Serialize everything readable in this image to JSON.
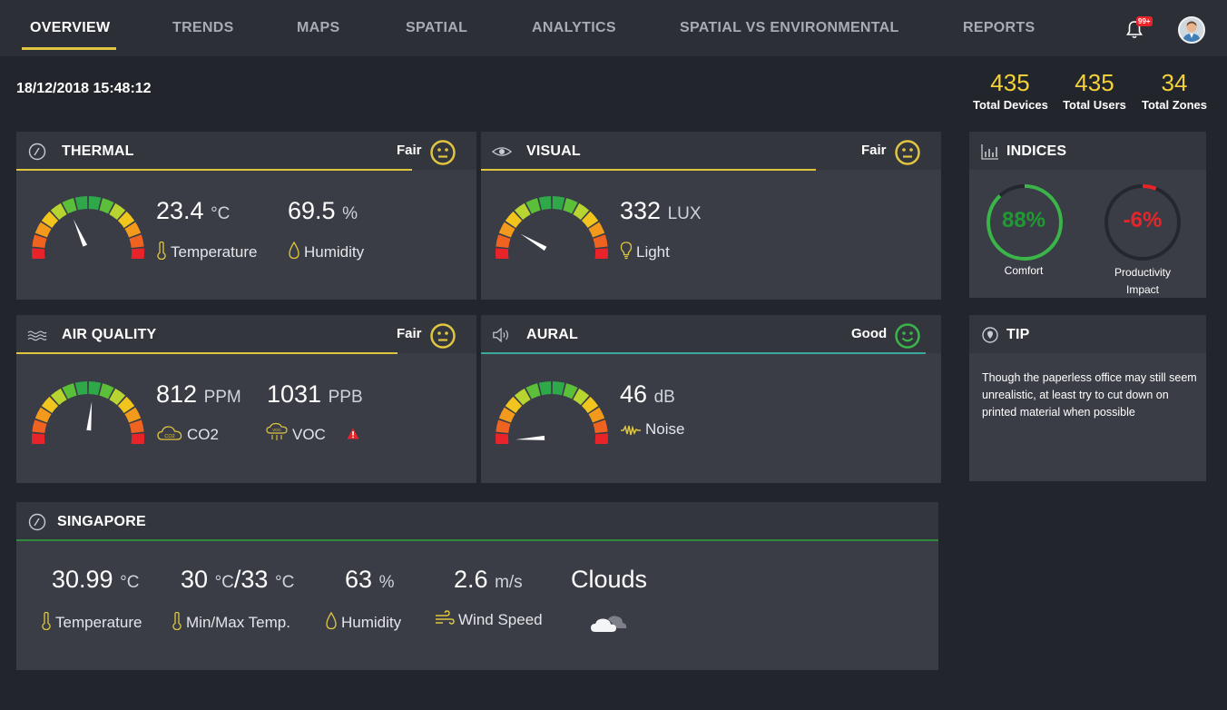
{
  "nav": {
    "tabs": [
      "OVERVIEW",
      "TRENDS",
      "MAPS",
      "SPATIAL",
      "ANALYTICS",
      "SPATIAL VS ENVIRONMENTAL",
      "REPORTS"
    ],
    "active_tab": "OVERVIEW",
    "notification_badge": "99+"
  },
  "timestamp": "18/12/2018 15:48:12",
  "stats": {
    "devices": {
      "value": "435",
      "label": "Total Devices"
    },
    "users": {
      "value": "435",
      "label": "Total Users"
    },
    "zones": {
      "value": "34",
      "label": "Total Zones"
    }
  },
  "thermal": {
    "title": "THERMAL",
    "status": "Fair",
    "temperature": {
      "value": "23.4",
      "unit": "°C",
      "label": "Temperature"
    },
    "humidity": {
      "value": "69.5",
      "unit": "%",
      "label": "Humidity"
    }
  },
  "visual": {
    "title": "VISUAL",
    "status": "Fair",
    "light": {
      "value": "332",
      "unit": "LUX",
      "label": "Light"
    }
  },
  "indices": {
    "title": "INDICES",
    "comfort": {
      "value": "88%",
      "label": "Comfort",
      "fraction": 0.88
    },
    "productivity": {
      "value": "-6%",
      "label_line1": "Productivity",
      "label_line2": "Impact",
      "fraction": 0.06
    }
  },
  "air_quality": {
    "title": "AIR QUALITY",
    "status": "Fair",
    "co2": {
      "value": "812",
      "unit": "PPM",
      "label": "CO2",
      "icon_text": "CO2"
    },
    "voc": {
      "value": "1031",
      "unit": "PPB",
      "label": "VOC",
      "icon_text": "VOC"
    }
  },
  "aural": {
    "title": "AURAL",
    "status": "Good",
    "noise": {
      "value": "46",
      "unit": "dB",
      "label": "Noise"
    }
  },
  "tip": {
    "title": "TIP",
    "text": "Though the paperless office may still seem unrealistic, at least try to cut down on printed material when possible"
  },
  "singapore": {
    "title": "SINGAPORE",
    "temperature": {
      "value": "30.99",
      "unit": "°C",
      "label": "Temperature"
    },
    "minmax": {
      "min": "30",
      "max": "33",
      "unit": "°C",
      "sep": "/",
      "label": "Min/Max Temp."
    },
    "humidity": {
      "value": "63",
      "unit": "%",
      "label": "Humidity"
    },
    "wind": {
      "value": "2.6",
      "unit": "m/s",
      "label": "Wind Speed"
    },
    "weather": {
      "value": "Clouds"
    }
  },
  "colors": {
    "accent": "#e0c640",
    "good": "#3bb54a",
    "bad": "#e8232a",
    "stat": "#f4d13a"
  },
  "gauges": {
    "thermal": 0.38,
    "visual": 0.2,
    "air_quality": 0.53,
    "aural": 0.03
  }
}
